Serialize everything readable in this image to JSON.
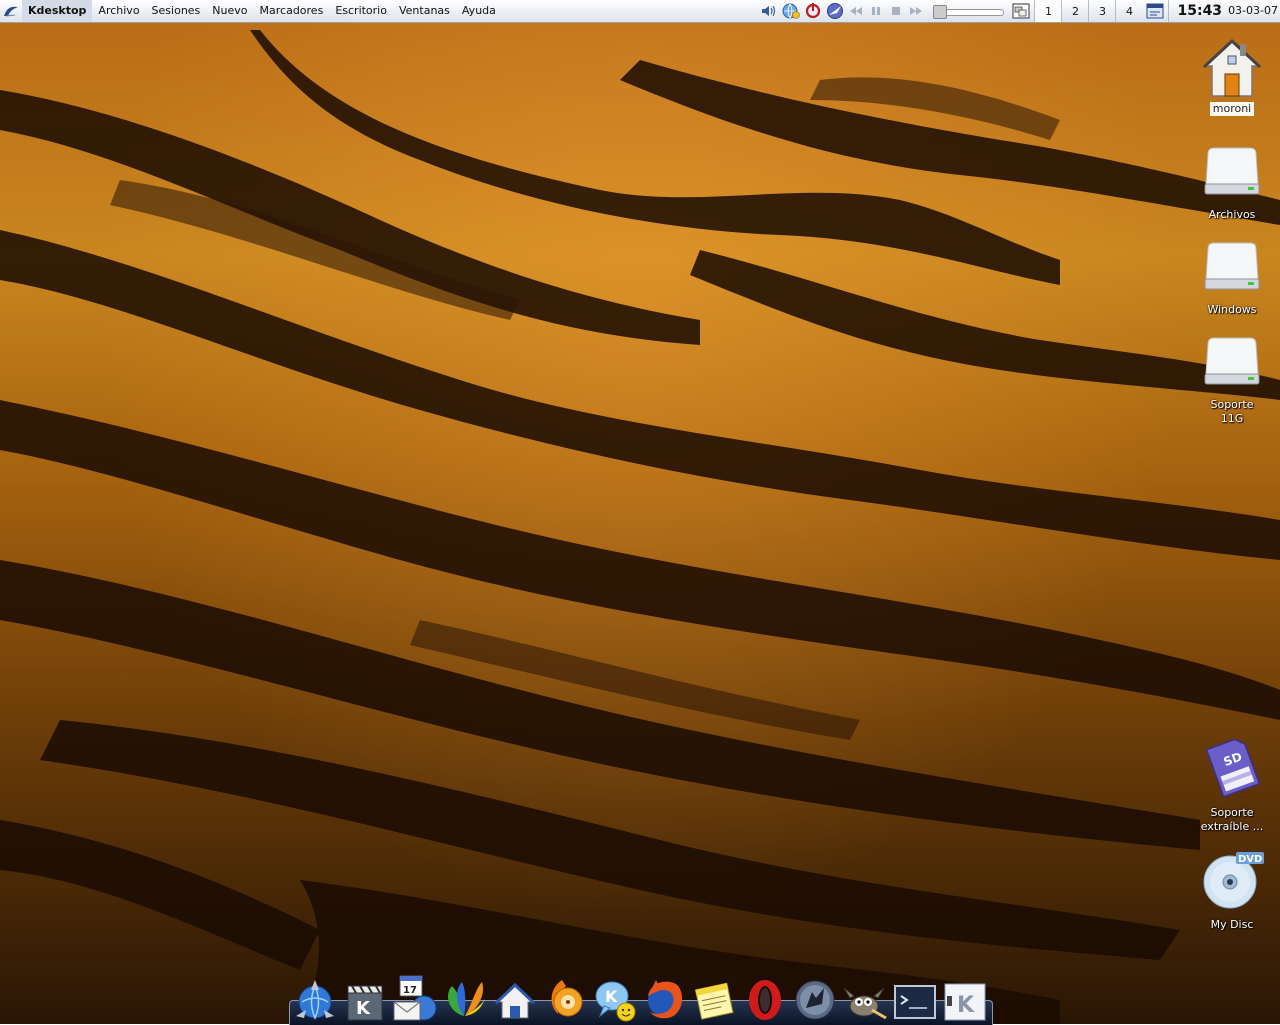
{
  "menubar": {
    "app_name": "Kdesktop",
    "menus": [
      "Archivo",
      "Sesiones",
      "Nuevo",
      "Marcadores",
      "Escritorio",
      "Ventanas",
      "Ayuda"
    ]
  },
  "tray": {
    "volume_level": 0.05,
    "pager": [
      "1",
      "2",
      "3",
      "4"
    ],
    "active_desktop": "1",
    "clock": "15:43",
    "date": "03-03-07"
  },
  "desktop_icons": {
    "home": "moroni",
    "archivos": "Archivos",
    "windows": "Windows",
    "soporte_line1": "Soporte",
    "soporte_line2": "11G",
    "removable_line1": "Soporte",
    "removable_line2": "extraíble ...",
    "sd_badge": "SD",
    "dvd_badge": "DVD",
    "dvd": "My Disc"
  },
  "dock": {
    "calendar_day": "17"
  },
  "icons": [
    "kde-menu-icon",
    "volume-icon",
    "network-icon",
    "shutdown-icon",
    "browser-icon",
    "previous-icon",
    "play-icon",
    "stop-icon",
    "next-icon",
    "taskbar-icon",
    "showdesktop-icon"
  ],
  "colors": {
    "menubar_top": "#ffffff",
    "menubar_bottom": "#dfe3ea",
    "dock_bg": "#0b1426",
    "wallpaper_orange": "#c9861f"
  }
}
